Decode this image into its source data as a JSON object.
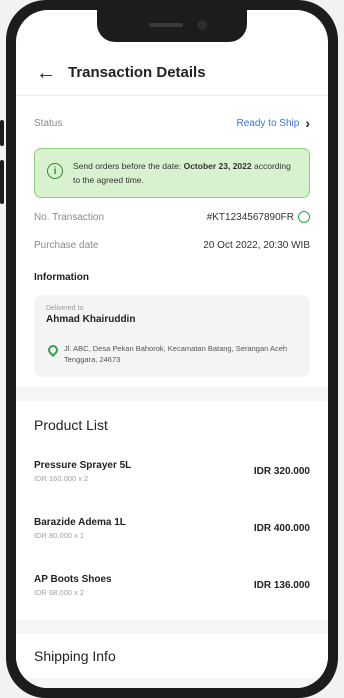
{
  "header": {
    "title": "Transaction Details"
  },
  "status": {
    "label": "Status",
    "value": "Ready to Ship"
  },
  "alert": {
    "text_before": "Send orders before the date: ",
    "date": "October 23, 2022",
    "text_after": " according to the agreed time."
  },
  "transaction": {
    "no_label": "No. Transaction",
    "no_value": "#KT1234567890FR",
    "date_label": "Purchase date",
    "date_value": "20 Oct 2022, 20:30 WIB"
  },
  "information": {
    "title": "Information",
    "delivered_to": "Delivered to",
    "name": "Ahmad Khairuddin",
    "address": "Jl. ABC, Desa Pekan Bahorok, Kecamatan Batang, Serangan Aceh Tenggara, 24673"
  },
  "product_list": {
    "title": "Product List",
    "items": [
      {
        "name": "Pressure Sprayer 5L",
        "detail": "IDR 160.000 x 2",
        "price": "IDR 320.000"
      },
      {
        "name": "Barazide Adema 1L",
        "detail": "IDR 80.000 x 1",
        "price": "IDR 400.000"
      },
      {
        "name": "AP Boots Shoes",
        "detail": "IDR 68.000 x 2",
        "price": "IDR 136.000"
      }
    ]
  },
  "shipping": {
    "title": "Shipping Info"
  }
}
